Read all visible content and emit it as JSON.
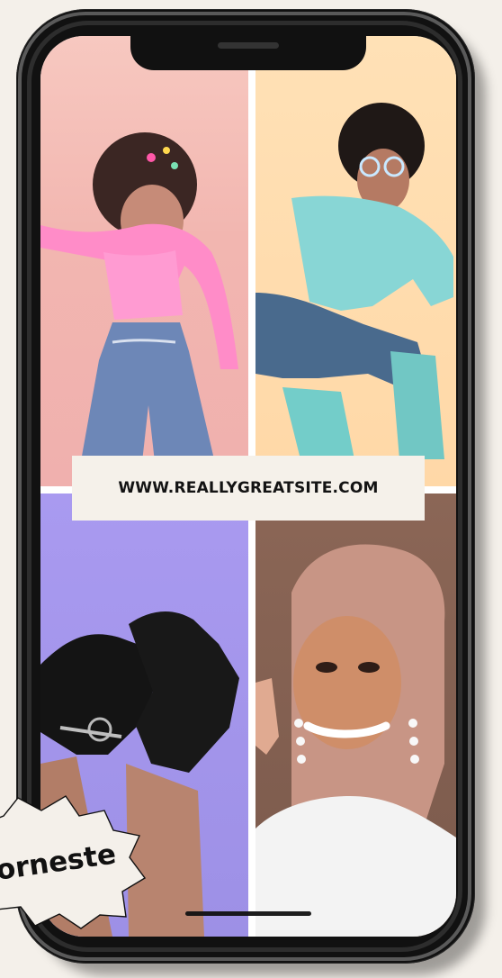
{
  "screen": {
    "website": "WWW.REALLYGREATSITE.COM"
  },
  "badge": {
    "text": "orneste"
  },
  "colors": {
    "page_background": "#f4f0ea",
    "phone_body": "#111111",
    "banner_background": "#f5f1ea",
    "top_left_tile": "#f2b6b0",
    "top_right_tile": "#ffd8a7",
    "bottom_left_tile": "#9d90e6",
    "bottom_right_tile": "#7b5a4c"
  },
  "icons": {
    "status_notch": "notch-icon",
    "home_indicator": "home-indicator-icon",
    "badge_shape": "starburst-badge-icon"
  }
}
